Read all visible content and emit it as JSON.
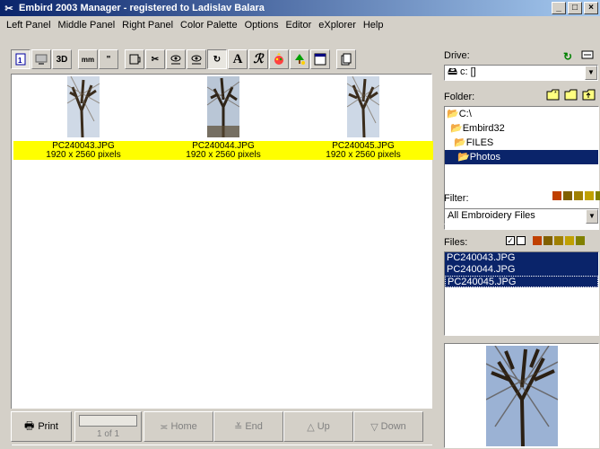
{
  "window": {
    "title": "Embird 2003 Manager - registered to Ladislav Balara",
    "min": "_",
    "max": "□",
    "close": "×"
  },
  "menu": [
    "Left Panel",
    "Middle Panel",
    "Right Panel",
    "Color Palette",
    "Options",
    "Editor",
    "eXplorer",
    "Help"
  ],
  "toolbar": {
    "b3d": "3D",
    "mm": "mm",
    "inch": "\"",
    "letterA": "A"
  },
  "thumbnails": [
    {
      "name": "PC240043.JPG",
      "size": "1920 x 2560 pixels"
    },
    {
      "name": "PC240044.JPG",
      "size": "1920 x 2560 pixels"
    },
    {
      "name": "PC240045.JPG",
      "size": "1920 x 2560 pixels"
    }
  ],
  "bottom": {
    "print": "Print",
    "page": "1 of 1",
    "home": "Home",
    "end": "End",
    "up": "Up",
    "down": "Down"
  },
  "right": {
    "drive_label": "Drive:",
    "drive_value": "c: []",
    "folder_label": "Folder:",
    "folders": [
      "C:\\",
      "Embird32",
      "FILES",
      "Photos"
    ],
    "filter_label": "Filter:",
    "filter_value": "All Embroidery Files",
    "files_label": "Files:",
    "files": [
      "PC240043.JPG",
      "PC240044.JPG",
      "PC240045.JPG"
    ]
  },
  "colors": {
    "selection": "#0a246a",
    "caption_highlight": "#ffff00",
    "title_start": "#0a246a",
    "title_end": "#a6caf0"
  }
}
